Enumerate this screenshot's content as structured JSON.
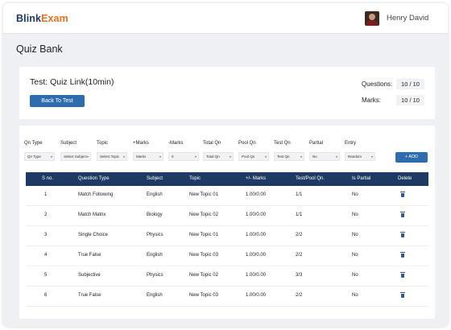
{
  "header": {
    "logo_part1": "Blink",
    "logo_part2": "Exam",
    "user_name": "Henry David"
  },
  "page": {
    "title": "Quiz Bank"
  },
  "test": {
    "title": "Test: Quiz Link(10min)",
    "back_button": "Back To Test",
    "questions_label": "Questions:",
    "questions_value": "10 / 10",
    "marks_label": "Marks:",
    "marks_value": "10 / 10"
  },
  "filters": {
    "labels": [
      "Qn Type",
      "Subject",
      "Topic",
      "+Marks",
      "-Marks",
      "Total Qn",
      "Pool Qn",
      "Test Qn",
      "Partial",
      "Entry"
    ],
    "values": [
      "Qn Type",
      "Select Subject",
      "Select Topic",
      "Marks",
      "0",
      "Total Qn",
      "Pool Qn",
      "Test Qn",
      "No",
      "Random"
    ],
    "add_button": "+ ADD"
  },
  "table": {
    "headers": [
      "S no.",
      "Question Type",
      "Subject",
      "Topic",
      "+/- Marks",
      "Test/Pool Qn.",
      "Is Partial",
      "Delete"
    ],
    "rows": [
      [
        "1",
        "Match Following",
        "English",
        "New Topic 01",
        "1.00/0.00",
        "1/1",
        "No"
      ],
      [
        "2",
        "Match Matrix",
        "Biology",
        "New Topic 02",
        "1.00/0.00",
        "1/1",
        "No"
      ],
      [
        "3",
        "Single Choice",
        "Physics",
        "New Topic 01",
        "1.00/0.00",
        "2/2",
        "No"
      ],
      [
        "4",
        "True False",
        "English",
        "New Topic 03",
        "1.00/0.00",
        "2/2",
        "No"
      ],
      [
        "5",
        "Subjective",
        "Physics",
        "New Topic 02",
        "1.00/0.00",
        "3/3",
        "No"
      ],
      [
        "6",
        "True False",
        "English",
        "New Topic 03",
        "1.00/0.00",
        "2/2",
        "No"
      ]
    ]
  }
}
